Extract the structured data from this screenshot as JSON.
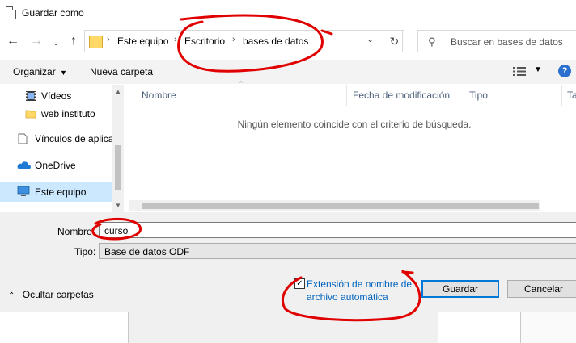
{
  "window": {
    "title": "Guardar como"
  },
  "address_bar": {
    "crumbs": [
      "Este equipo",
      "Escritorio",
      "bases de datos"
    ]
  },
  "search": {
    "placeholder": "Buscar en bases de datos"
  },
  "toolbar": {
    "organize_label": "Organizar",
    "new_folder_label": "Nueva carpeta"
  },
  "nav_pane": {
    "items": [
      {
        "label": "Vídeos",
        "icon": "video-folder-icon"
      },
      {
        "label": "web instituto",
        "icon": "folder-icon"
      },
      {
        "label": "Vínculos de aplica",
        "icon": "document-icon"
      },
      {
        "label": "OneDrive",
        "icon": "cloud-icon"
      },
      {
        "label": "Este equipo",
        "icon": "computer-icon",
        "selected": true
      }
    ]
  },
  "file_list": {
    "columns": [
      "Nombre",
      "Fecha de modificación",
      "Tipo",
      "Ta"
    ],
    "empty_message": "Ningún elemento coincide con el criterio de búsqueda."
  },
  "form": {
    "name_label": "Nombre",
    "name_value": "curso",
    "type_label": "Tipo:",
    "type_value": "Base de datos ODF",
    "auto_extension_label": "Extensión de nombre de archivo automática",
    "auto_extension_checked": true
  },
  "footer": {
    "hide_folders_label": "Ocultar carpetas"
  },
  "buttons": {
    "save_label": "Guardar",
    "cancel_label": "Cancelar"
  },
  "colors": {
    "accent": "#0078d7",
    "link": "#0064bf",
    "annotation": "#e00000"
  }
}
